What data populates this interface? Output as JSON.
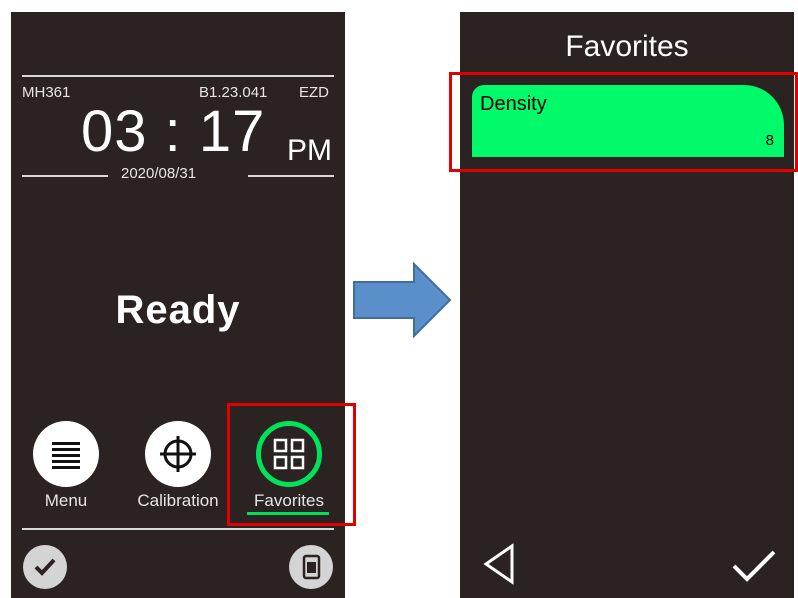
{
  "home_screen": {
    "model": "MH361",
    "firmware": "B1.23.041",
    "mode": "EZD",
    "time": "03 : 17",
    "ampm": "PM",
    "date": "2020/08/31",
    "status": "Ready",
    "nav": {
      "menu_label": "Menu",
      "calibration_label": "Calibration",
      "favorites_label": "Favorites",
      "menu_icon": "list-icon",
      "calibration_icon": "crosshair-icon",
      "favorites_icon": "grid-icon"
    },
    "bottom_bar": {
      "left_icon": "check-icon",
      "right_icon": "device-icon"
    }
  },
  "favorites_screen": {
    "title": "Favorites",
    "items": [
      {
        "name": "Density",
        "count": "8"
      }
    ],
    "bottom_bar": {
      "back_icon": "triangle-left-icon",
      "confirm_icon": "check-icon"
    }
  },
  "colors": {
    "screen_bg": "#2a2321",
    "accent_green": "#00e25a",
    "item_green": "#00fa6a",
    "highlight_red": "#e00000",
    "arrow_blue": "#5b8fc9"
  }
}
